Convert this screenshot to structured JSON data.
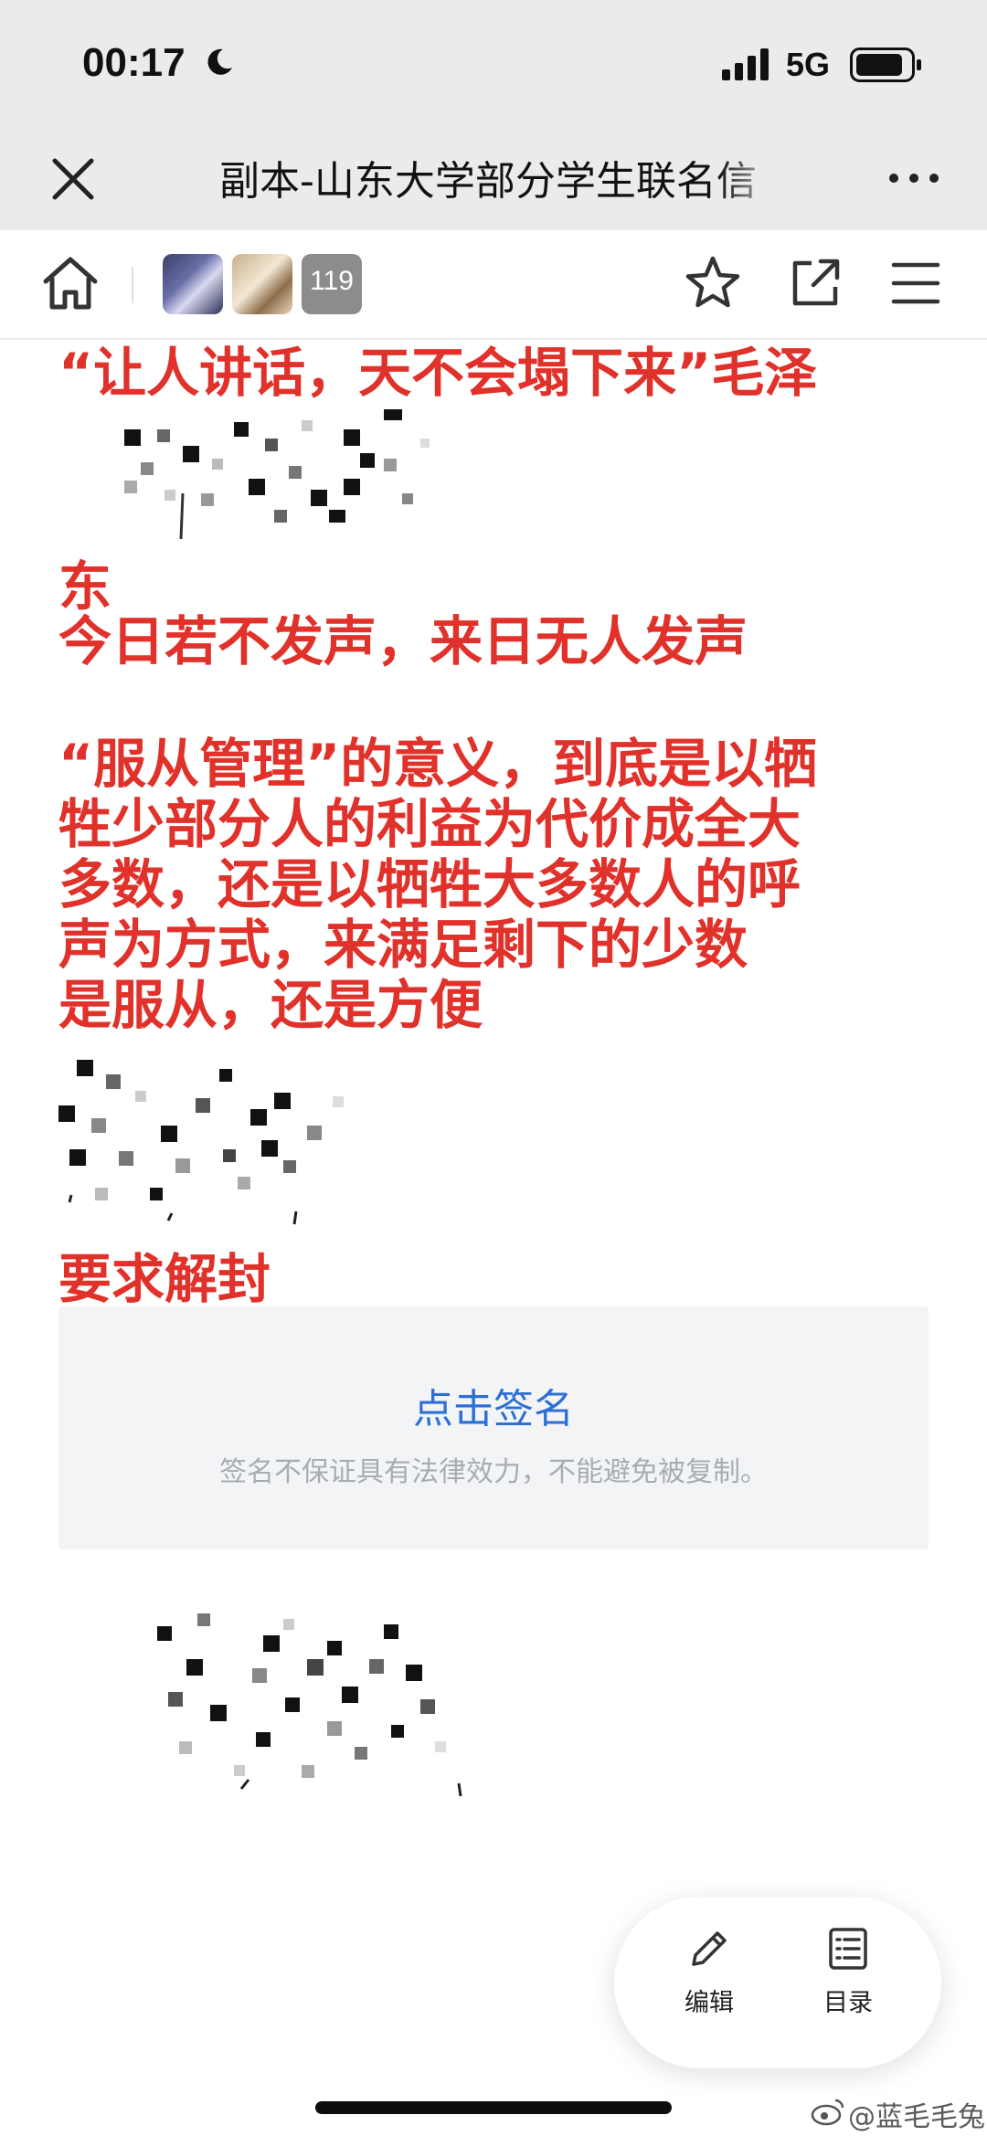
{
  "status_bar": {
    "time": "00:17",
    "network": "5G"
  },
  "title_bar": {
    "title": "副本-山东大学部分学生联名信"
  },
  "toolbar": {
    "collaborator_count": "119"
  },
  "document": {
    "line1": "“让人讲话，天不会塌下来”毛泽",
    "line2": "东",
    "line3": "今日若不发声，来日无人发声",
    "line4": "“服从管理”的意义，到底是以牺",
    "line5": "牲少部分人的利益为代价成全大",
    "line6": "多数，还是以牺牲大多数人的呼",
    "line7": "声为方式，来满足剩下的少数",
    "line8": "是服从，还是方便",
    "line9": "要求解封"
  },
  "signature": {
    "button_label": "点击签名",
    "note": "签名不保证具有法律效力，不能避免被复制。"
  },
  "floating_panel": {
    "edit_label": "编辑",
    "toc_label": "目录"
  },
  "watermark": {
    "text": "@蓝毛毛兔"
  },
  "colors": {
    "text_red": "#e0312a",
    "link_blue": "#2d6fd6",
    "header_bg": "#ebebeb"
  }
}
